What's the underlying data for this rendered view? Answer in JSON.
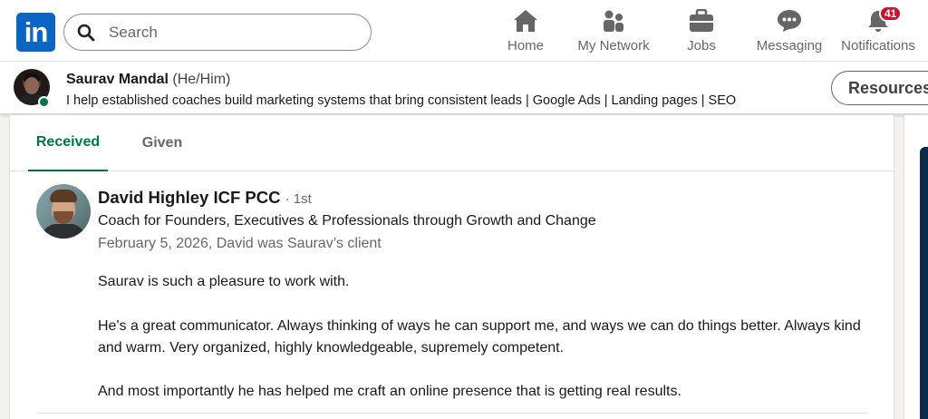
{
  "nav": {
    "logo": "in",
    "search_placeholder": "Search",
    "items": [
      {
        "label": "Home",
        "icon": "home-icon"
      },
      {
        "label": "My Network",
        "icon": "people-icon"
      },
      {
        "label": "Jobs",
        "icon": "briefcase-icon"
      },
      {
        "label": "Messaging",
        "icon": "chat-icon"
      },
      {
        "label": "Notifications",
        "icon": "bell-icon",
        "badge": "41"
      }
    ]
  },
  "profile_bar": {
    "name": "Saurav Mandal",
    "pronouns": "(He/Him)",
    "headline": "I help established coaches build marketing systems that bring consistent leads | Google Ads | Landing pages | SEO",
    "resources_label": "Resources"
  },
  "tabs": {
    "received": "Received",
    "given": "Given",
    "active": "received"
  },
  "recommendation": {
    "name": "David Highley ICF PCC",
    "degree": "· 1st",
    "headline": "Coach for Founders, Executives & Professionals through Growth and Change",
    "meta": "February 5, 2026, David was Saurav’s client",
    "paragraphs": [
      "Saurav is such a pleasure to work with.",
      "He's a great communicator. Always thinking of ways he can support me, and ways we can do things better. Always kind and warm. Very organized, highly knowledgeable, supremely competent.",
      "And most importantly he has helped me craft an online presence that is getting real results."
    ]
  },
  "colors": {
    "brand": "#0a66c2",
    "active_tab": "#01754f",
    "badge": "#cb112d"
  }
}
